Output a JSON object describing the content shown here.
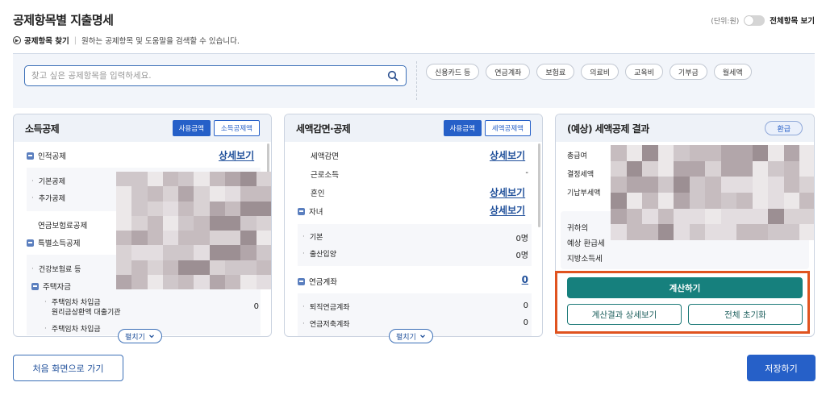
{
  "header": {
    "title": "공제항목별 지출명세",
    "helper_label": "공제항목 찾기",
    "helper_text": "원하는 공제항목 및 도움말을 검색할 수 있습니다.",
    "unit": "(단위:원)",
    "toggle_label": "전체항목 보기"
  },
  "search": {
    "placeholder": "찾고 싶은 공제항목을 입력하세요.",
    "chips": [
      "신용카드 등",
      "연금계좌",
      "보험료",
      "의료비",
      "교육비",
      "기부금",
      "월세액"
    ]
  },
  "income_panel": {
    "title": "소득공제",
    "btn_used": "사용금액",
    "btn_deduct": "소득공제액",
    "personal": "인적공제",
    "detail": "상세보기",
    "basic": "기본공제",
    "additional": "추가공제",
    "pension": "연금보험료공제",
    "special": "특별소득공제",
    "health": "건강보험료 등",
    "housing": "주택자금",
    "housing_loan_1": "주택임차 차입금",
    "housing_loan_2": "원리금상환액 대출기관",
    "housing_loan_value": "0",
    "housing_loan_cut": "주택임차 차입금",
    "expand": "펼치기"
  },
  "tax_panel": {
    "title": "세액감면·공제",
    "btn_used": "사용금액",
    "btn_deduct": "세액공제액",
    "reduction": "세액감면",
    "earned": "근로소득",
    "earned_value": "-",
    "marriage": "혼인",
    "children": "자녀",
    "detail": "상세보기",
    "child_basic": "기본",
    "child_basic_value": "0명",
    "childbirth": "출산입양",
    "childbirth_value": "0명",
    "pension_account": "연금계좌",
    "pension_account_value": "0",
    "retirement": "퇴직연금계좌",
    "retirement_value": "0",
    "savings": "연금저축계좌",
    "savings_value": "0",
    "expand": "펼치기"
  },
  "result_panel": {
    "title": "(예상) 세액공제 결과",
    "refund_badge": "환급",
    "total_salary": "총급여",
    "determined_tax": "결정세액",
    "prepaid_tax": "기납부세액",
    "your_label": "귀하의",
    "expected_refund": "예상 환급세",
    "local_tax": "지방소득세",
    "calc_button": "계산하기",
    "detail_button": "계산결과 상세보기",
    "reset_button": "전체 초기화"
  },
  "footer": {
    "home_button": "처음 화면으로 가기",
    "save_button": "저장하기"
  },
  "colors": {
    "primary": "#2660c8",
    "teal": "#16807d",
    "highlight": "#e0531f"
  }
}
